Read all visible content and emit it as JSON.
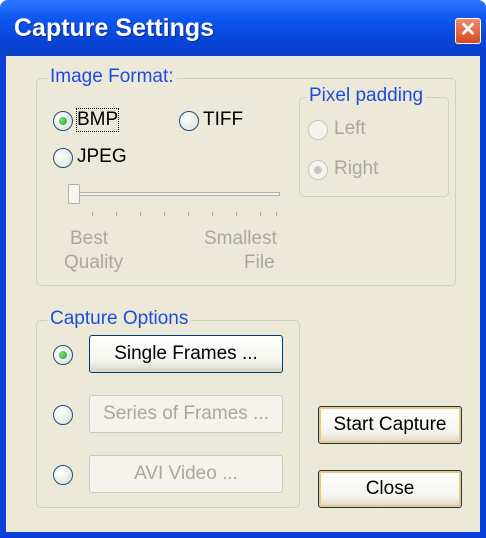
{
  "window": {
    "title": "Capture Settings",
    "close_glyph": "✕"
  },
  "image_format": {
    "legend": "Image Format:",
    "options": [
      {
        "label": "BMP",
        "selected": true
      },
      {
        "label": "TIFF",
        "selected": false
      },
      {
        "label": "JPEG",
        "selected": false
      }
    ],
    "quality_slider": {
      "value": 0,
      "min_label_line1": "Best",
      "min_label_line2": "Quality",
      "max_label_line1": "Smallest",
      "max_label_line2": "File",
      "enabled": false
    }
  },
  "pixel_padding": {
    "legend": "Pixel padding",
    "enabled": false,
    "options": [
      {
        "label": "Left",
        "selected": false
      },
      {
        "label": "Right",
        "selected": true
      }
    ]
  },
  "capture_options": {
    "legend": "Capture Options",
    "options": [
      {
        "label": "Single Frames ...",
        "selected": true,
        "enabled": true
      },
      {
        "label": "Series of Frames ...",
        "selected": false,
        "enabled": false
      },
      {
        "label": "AVI Video ...",
        "selected": false,
        "enabled": false
      }
    ]
  },
  "actions": {
    "start_label": "Start Capture",
    "close_label": "Close"
  },
  "colors": {
    "title_bar": "#0a3fd8",
    "client": "#ece9d8",
    "legend": "#1e4ddc",
    "disabled_text": "#aca899"
  }
}
